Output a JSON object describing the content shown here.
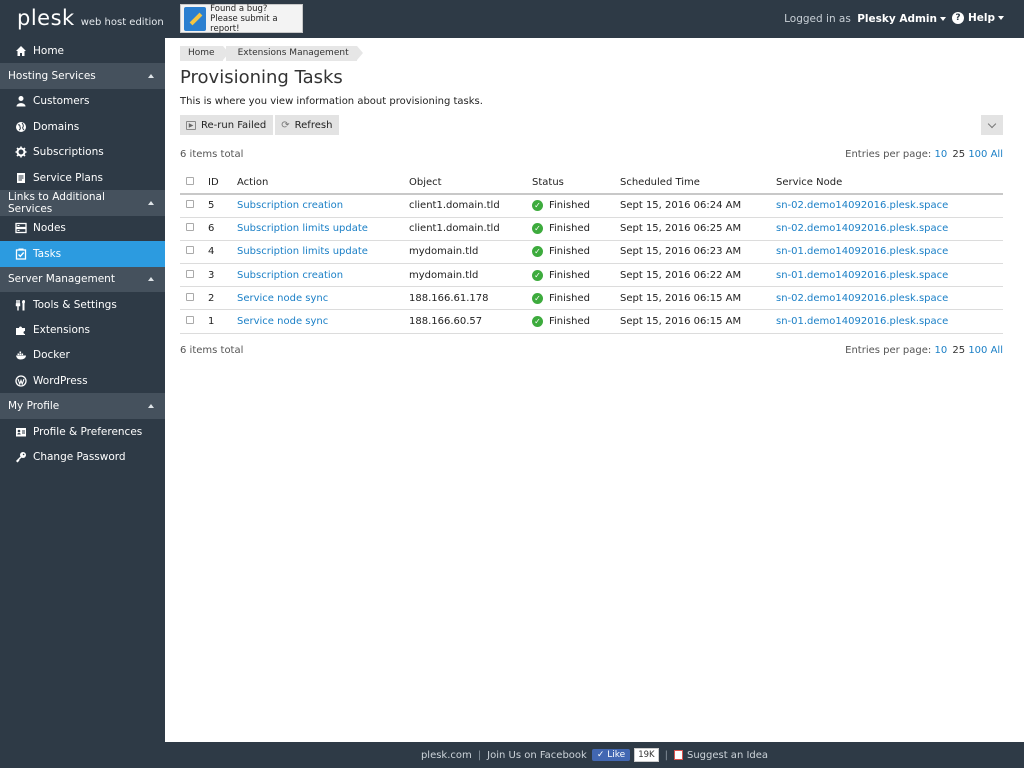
{
  "header": {
    "brand": "plesk",
    "edition": "web host edition",
    "bug_line1": "Found a bug?",
    "bug_line2": "Please submit a report!",
    "logged_in_label": "Logged in as",
    "user": "Plesky Admin",
    "help": "Help"
  },
  "sidebar": {
    "home": "Home",
    "hosting_services": "Hosting Services",
    "customers": "Customers",
    "domains": "Domains",
    "subscriptions": "Subscriptions",
    "service_plans": "Service Plans",
    "links_additional": "Links to Additional Services",
    "nodes": "Nodes",
    "tasks": "Tasks",
    "server_management": "Server Management",
    "tools_settings": "Tools & Settings",
    "extensions": "Extensions",
    "docker": "Docker",
    "wordpress": "WordPress",
    "my_profile": "My Profile",
    "profile_prefs": "Profile & Preferences",
    "change_password": "Change Password"
  },
  "breadcrumb": [
    "Home",
    "Extensions Management"
  ],
  "page": {
    "title": "Provisioning Tasks",
    "description": "This is where you view information about provisioning tasks.",
    "rerun_failed": "Re-run Failed",
    "refresh": "Refresh",
    "items_total": "6 items total",
    "entries_label": "Entries per page:",
    "entries_options": [
      "10",
      "25",
      "100",
      "All"
    ]
  },
  "table": {
    "headers": [
      "ID",
      "Action",
      "Object",
      "Status",
      "Scheduled Time",
      "Service Node"
    ],
    "rows": [
      {
        "id": "5",
        "action": "Subscription creation",
        "object": "client1.domain.tld",
        "status": "Finished",
        "time": "Sept 15, 2016 06:24 AM",
        "node": "sn-02.demo14092016.plesk.space"
      },
      {
        "id": "6",
        "action": "Subscription limits update",
        "object": "client1.domain.tld",
        "status": "Finished",
        "time": "Sept 15, 2016 06:25 AM",
        "node": "sn-02.demo14092016.plesk.space"
      },
      {
        "id": "4",
        "action": "Subscription limits update",
        "object": "mydomain.tld",
        "status": "Finished",
        "time": "Sept 15, 2016 06:23 AM",
        "node": "sn-01.demo14092016.plesk.space"
      },
      {
        "id": "3",
        "action": "Subscription creation",
        "object": "mydomain.tld",
        "status": "Finished",
        "time": "Sept 15, 2016 06:22 AM",
        "node": "sn-01.demo14092016.plesk.space"
      },
      {
        "id": "2",
        "action": "Service node sync",
        "object": "188.166.61.178",
        "status": "Finished",
        "time": "Sept 15, 2016 06:15 AM",
        "node": "sn-02.demo14092016.plesk.space"
      },
      {
        "id": "1",
        "action": "Service node sync",
        "object": "188.166.60.57",
        "status": "Finished",
        "time": "Sept 15, 2016 06:15 AM",
        "node": "sn-01.demo14092016.plesk.space"
      }
    ]
  },
  "footer": {
    "plesk_link": "plesk.com",
    "facebook": "Join Us on Facebook",
    "like": "Like",
    "like_count": "19K",
    "suggest": "Suggest an Idea"
  },
  "colors": {
    "sidebar_bg": "#2e3a46",
    "active": "#2c9be0",
    "link": "#1a7fc6",
    "ok": "#3dab3d"
  }
}
